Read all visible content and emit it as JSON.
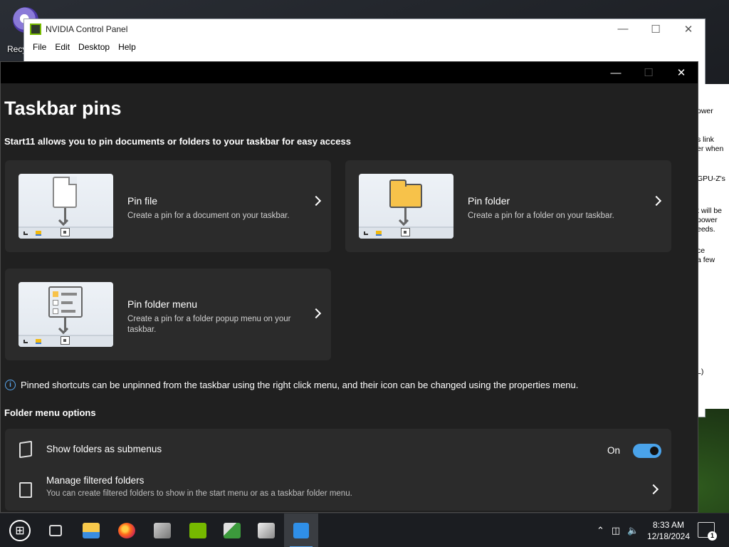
{
  "desktop": {
    "recycle_bin_label": "Recy"
  },
  "nvidia_window": {
    "title": "NVIDIA Control Panel",
    "menu": [
      "File",
      "Edit",
      "Desktop",
      "Help"
    ],
    "side_text": [
      "ower",
      "s link",
      "er when",
      "GPU-Z's",
      "t will be",
      "power",
      "eeds.",
      "ce",
      "a few",
      "L)"
    ]
  },
  "start11_window": {
    "page_title": "Taskbar pins",
    "subtitle": "Start11 allows you to pin documents or folders to your taskbar for easy access",
    "cards": [
      {
        "title": "Pin file",
        "description": "Create a pin for a document on your taskbar.",
        "icon": "document-pin-illustration"
      },
      {
        "title": "Pin folder",
        "description": "Create a pin for a folder on your taskbar.",
        "icon": "folder-pin-illustration"
      },
      {
        "title": "Pin folder menu",
        "description": "Create a pin for a folder popup menu on your taskbar.",
        "icon": "folder-menu-pin-illustration"
      }
    ],
    "info_text": "Pinned shortcuts can be unpinned from the taskbar using the right click menu, and their icon can be changed using the properties menu.",
    "folder_menu_section_title": "Folder menu options",
    "options": {
      "show_submenus": {
        "title": "Show folders as submenus",
        "state_label": "On",
        "enabled": true
      },
      "filtered_folders": {
        "title": "Manage filtered folders",
        "description": "You can create filtered folders to show in the start menu or as a taskbar folder menu."
      }
    }
  },
  "taskbar": {
    "apps": [
      "start",
      "task-view",
      "file-explorer",
      "firefox",
      "app",
      "nvidia-control-panel",
      "gpu-z",
      "app",
      "start11"
    ],
    "time": "8:33 AM",
    "date": "12/18/2024",
    "notification_count": "1"
  },
  "colors": {
    "accent": "#4aa3ea",
    "window_bg": "#202020",
    "card_bg": "#2b2b2b"
  }
}
